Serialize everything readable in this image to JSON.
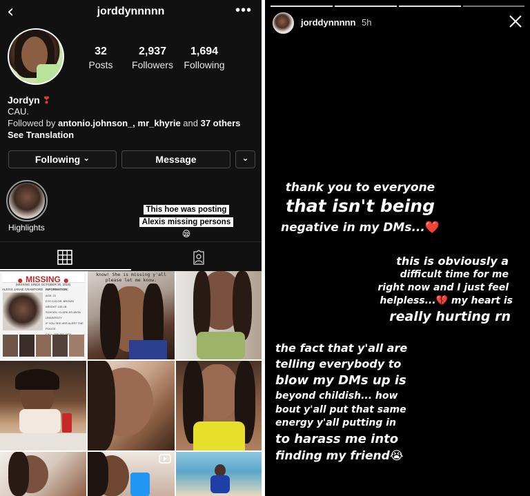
{
  "profile": {
    "back_glyph": "‹",
    "username": "jorddynnnnn",
    "more_glyph": "•••",
    "stats": [
      {
        "num": "32",
        "label": "Posts"
      },
      {
        "num": "2,937",
        "label": "Followers"
      },
      {
        "num": "1,694",
        "label": "Following"
      }
    ],
    "name": "Jordyn",
    "name_emoji": "❣",
    "bio": "CAU.",
    "followed_prefix": "Followed by ",
    "followed_users": "antonio.johnson_, mr_khyrie",
    "followed_mid": " and ",
    "followed_others": "37 others",
    "see_translation": "See Translation",
    "following_button": "Following",
    "following_chevron": "⌄",
    "message_button": "Message",
    "dropdown_chevron": "⌄",
    "highlights_label": "Highlights",
    "overlay_caption_line1": "This hoe was posting",
    "overlay_caption_line2": "Alexis missing persons",
    "overlay_emoji": "😪",
    "grid_icon": "grid-icon",
    "tagged_icon": "tagged-person-icon"
  },
  "grid_posts": {
    "missing_title": "MISSING",
    "missing_since": "(MISSING SINCE OCTOBER 30, 2019)",
    "missing_name": "ALEXIS JANAE CRAWFORD",
    "missing_info_header": "INFORMATION:",
    "missing_info_lines": [
      "AGE: 21",
      "EYE COLOR: BROWN",
      "WEIGHT: 135 LB",
      "SCHOOL: CLARK ATLANTA UNIVERSITY",
      "IF YOU SEE HER ALERT THE POLICE",
      "CALL: 706-352-1874"
    ],
    "post2_caption": "know! She is missing y'all\nplease let me know.",
    "video_icon": "video-icon"
  },
  "story": {
    "username": "jorddynnnnn",
    "time": "5h",
    "close_icon": "close-icon",
    "block1": {
      "line1": "thank you to everyone",
      "line2": "that isn't being",
      "line3": "negative in my DMs...",
      "emoji": "❤️"
    },
    "block2": {
      "line1": "this is obviously a",
      "line2": "difficult time for me",
      "line3": "right now and I just feel",
      "line4_a": "helpless...",
      "line4_emoji": "💔",
      "line4_b": " my heart is",
      "line5": "really hurting rn"
    },
    "block3": {
      "line1": "the fact that y'all are",
      "line2": "telling everybody to",
      "line3": "blow my DMs up is",
      "line4": "beyond childish... how",
      "line5": "bout y'all put that same",
      "line6": "energy y'all putting in",
      "line7": "to harass me into",
      "line8": "finding my friend",
      "emoji": "😭"
    }
  },
  "colors": {
    "profile_bg": "#111111",
    "story_bg": "#000000",
    "heart": "#ff3b3b",
    "missing_red": "#c62828"
  }
}
